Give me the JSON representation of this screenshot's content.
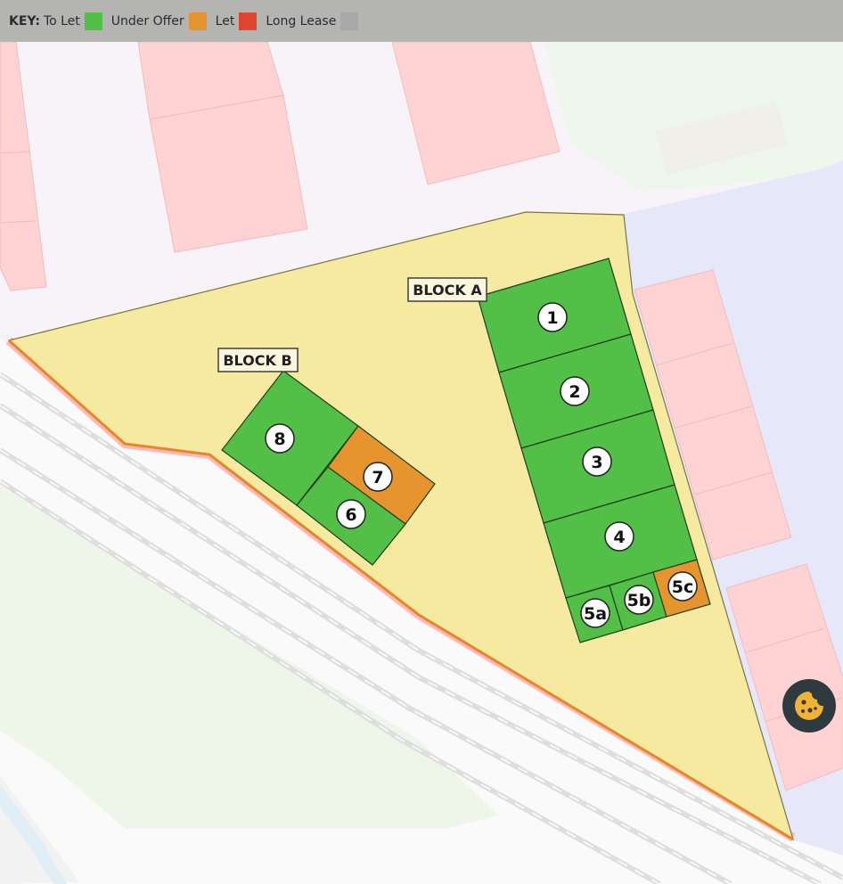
{
  "key": {
    "title": "KEY:",
    "items": [
      {
        "label": "To Let",
        "color": "#52bf47"
      },
      {
        "label": "Under Offer",
        "color": "#e6952e"
      },
      {
        "label": "Let",
        "color": "#e0452f"
      },
      {
        "label": "Long Lease",
        "color": "#a9a9a9"
      }
    ]
  },
  "blocks": {
    "a": {
      "label": "BLOCK A"
    },
    "b": {
      "label": "BLOCK B"
    }
  },
  "units": {
    "u1": {
      "label": "1",
      "status": "To Let"
    },
    "u2": {
      "label": "2",
      "status": "To Let"
    },
    "u3": {
      "label": "3",
      "status": "To Let"
    },
    "u4": {
      "label": "4",
      "status": "To Let"
    },
    "u5a": {
      "label": "5a",
      "status": "To Let"
    },
    "u5b": {
      "label": "5b",
      "status": "To Let"
    },
    "u5c": {
      "label": "5c",
      "status": "Under Offer"
    },
    "u6": {
      "label": "6",
      "status": "To Let"
    },
    "u7": {
      "label": "7",
      "status": "Under Offer"
    },
    "u8": {
      "label": "8",
      "status": "To Let"
    }
  },
  "colors": {
    "site": "#f6e9a0",
    "to_let": "#52bf47",
    "under_offer": "#e6952e",
    "building": "#ffd3d3",
    "park": "#eef7ec",
    "residential": "#e6e8fa",
    "road": "#fafafa",
    "rail": "#dcdcdc",
    "site_edge": "#e4872a",
    "cookie_button": "#2f3a40",
    "cookie_icon": "#f2b233"
  },
  "controls": {
    "cookie_icon": "cookie-icon"
  }
}
